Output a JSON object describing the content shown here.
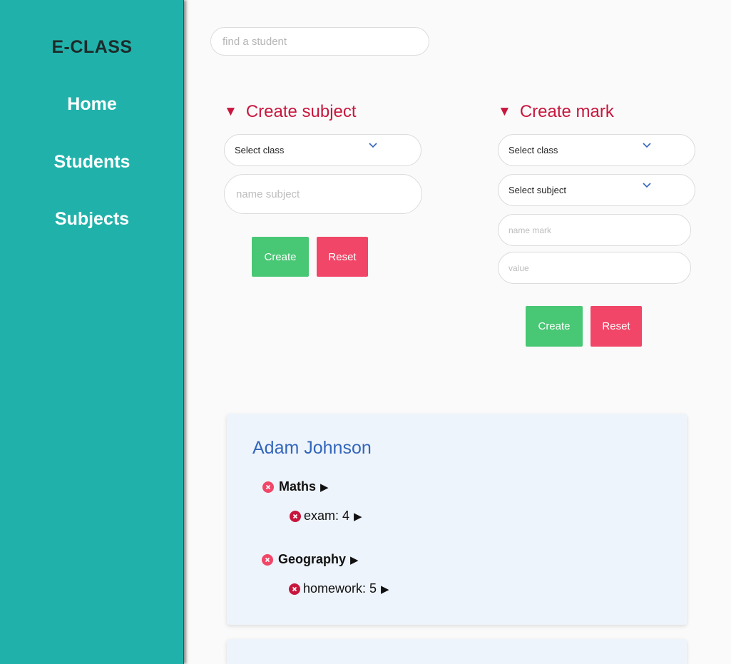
{
  "sidebar": {
    "brand": "E-CLASS",
    "items": [
      {
        "label": "Home"
      },
      {
        "label": "Students"
      },
      {
        "label": "Subjects"
      }
    ]
  },
  "search": {
    "placeholder": "find a student"
  },
  "create_subject": {
    "title": "Create subject",
    "class_select": "Select class",
    "name_placeholder": "name subject",
    "create_label": "Create",
    "reset_label": "Reset"
  },
  "create_mark": {
    "title": "Create mark",
    "class_select": "Select class",
    "subject_select": "Select subject",
    "name_placeholder": "name mark",
    "value_placeholder": "value",
    "create_label": "Create",
    "reset_label": "Reset"
  },
  "students": [
    {
      "name": "Adam Johnson",
      "subjects": [
        {
          "name": "Maths",
          "marks": [
            {
              "text": "exam: 4"
            }
          ]
        },
        {
          "name": "Geography",
          "marks": [
            {
              "text": "homework: 5"
            }
          ]
        }
      ]
    }
  ],
  "icons": {
    "collapse": "triangle-down",
    "expand": "triangle-right",
    "delete": "x-circle",
    "dropdown": "chevron-down"
  },
  "colors": {
    "sidebar": "#20b2aa",
    "accent": "#c8163d",
    "create": "#48c774",
    "reset": "#f14668",
    "student_name": "#3366bb",
    "card": "#eef4fb"
  }
}
